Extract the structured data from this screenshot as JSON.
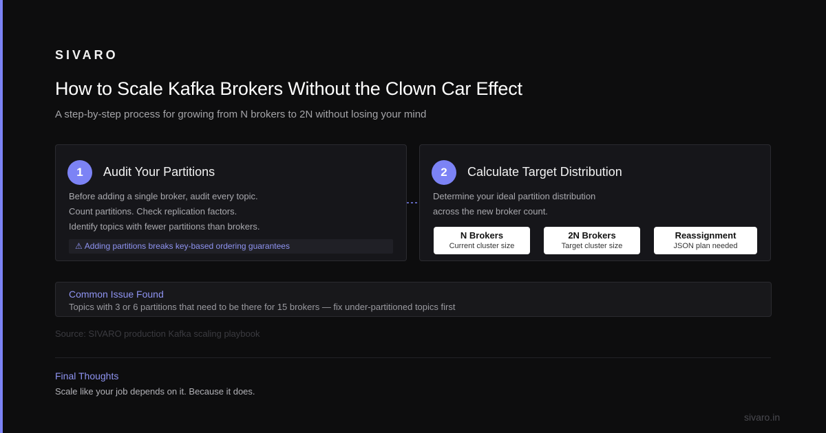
{
  "brand": "SIVARO",
  "title": "How to Scale Kafka Brokers Without the Clown Car Effect",
  "subtitle": "A step-by-step process for growing from N brokers to 2N without losing your mind",
  "steps": [
    {
      "number": "1",
      "title": "Audit Your Partitions",
      "lines": [
        "Before adding a single broker, audit every topic.",
        "Count partitions. Check replication factors.",
        "Identify topics with fewer partitions than brokers."
      ],
      "warning": {
        "icon": "⚠",
        "icon_name": "warning-icon",
        "text": "Adding partitions breaks key-based ordering guarantees"
      }
    },
    {
      "number": "2",
      "title": "Calculate Target Distribution",
      "lines": [
        "Determine your ideal partition distribution",
        "across the new broker count."
      ],
      "pills": [
        {
          "title": "N Brokers",
          "sub": "Current cluster size"
        },
        {
          "title": "2N Brokers",
          "sub": "Target cluster size"
        },
        {
          "title": "Reassignment",
          "sub": "JSON plan needed"
        }
      ]
    }
  ],
  "connector_icon": "dashed-arrow-right-icon",
  "issue": {
    "title": "Common Issue Found",
    "text": "Topics with 3 or 6 partitions that need to be there for 15 brokers — fix under-partitioned topics first"
  },
  "source": "Source: SIVARO production Kafka scaling playbook",
  "final": {
    "title": "Final Thoughts",
    "text": "Scale like your job depends on it. Because it does."
  },
  "footer_url": "sivaro.in",
  "colors": {
    "accent": "#7c83f5",
    "background": "#0d0d0e",
    "card": "#16161a"
  }
}
